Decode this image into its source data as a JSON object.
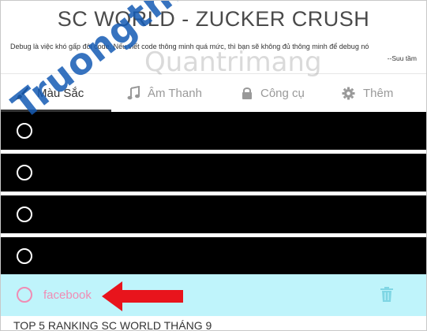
{
  "header": {
    "title": "SC WORLD - ZUCKER CRUSH",
    "quote": "Debug là việc khó gấp đôi code. Nếu viết code thông minh quá mức, thì bạn sẽ không đủ thông minh để debug nó",
    "credit": "--Suu tầm"
  },
  "tabs": [
    {
      "label": "Màu Sắc",
      "icon": "brush-icon",
      "active": true
    },
    {
      "label": "Âm Thanh",
      "icon": "music-note-icon",
      "active": false
    },
    {
      "label": "Công cụ",
      "icon": "lock-icon",
      "active": false
    },
    {
      "label": "Thêm",
      "icon": "gear-icon",
      "active": false
    }
  ],
  "options": [
    {
      "label": "",
      "color": "#000000"
    },
    {
      "label": "",
      "color": "#000000"
    },
    {
      "label": "",
      "color": "#000000"
    },
    {
      "label": "",
      "color": "#000000"
    },
    {
      "label": "facebook",
      "color": "#bff4fb",
      "text_color": "#f08cb4"
    }
  ],
  "bottom_text": "TOP 5 RANKING SC WORLD THÁNG 9",
  "watermarks": {
    "primary": "Truongthi.ton",
    "secondary": "Quantrimang"
  },
  "colors": {
    "active_tab": "#333333",
    "inactive_tab": "#999999",
    "facebook_text": "#f08cb4",
    "facebook_bg": "#bff4fb",
    "arrow": "#e8141c"
  }
}
